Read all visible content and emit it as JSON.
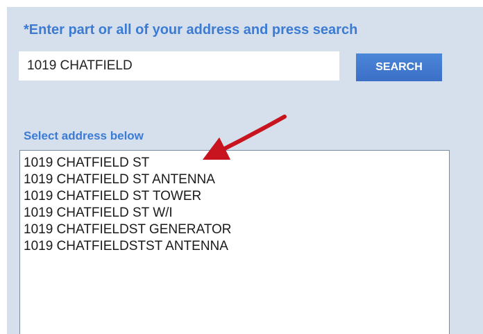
{
  "form": {
    "instruction": "*Enter part or all of your address and press search",
    "search_value": "1019 CHATFIELD",
    "search_label": "SEARCH",
    "select_label": "Select address below"
  },
  "results": [
    "1019 CHATFIELD ST",
    "1019 CHATFIELD ST ANTENNA",
    "1019 CHATFIELD ST TOWER",
    "1019 CHATFIELD ST W/I",
    "1019 CHATFIELDST GENERATOR",
    "1019 CHATFIELDSTST ANTENNA"
  ],
  "annotation": {
    "arrow_color": "#c8141e",
    "arrow_icon": "red-arrow-icon"
  }
}
